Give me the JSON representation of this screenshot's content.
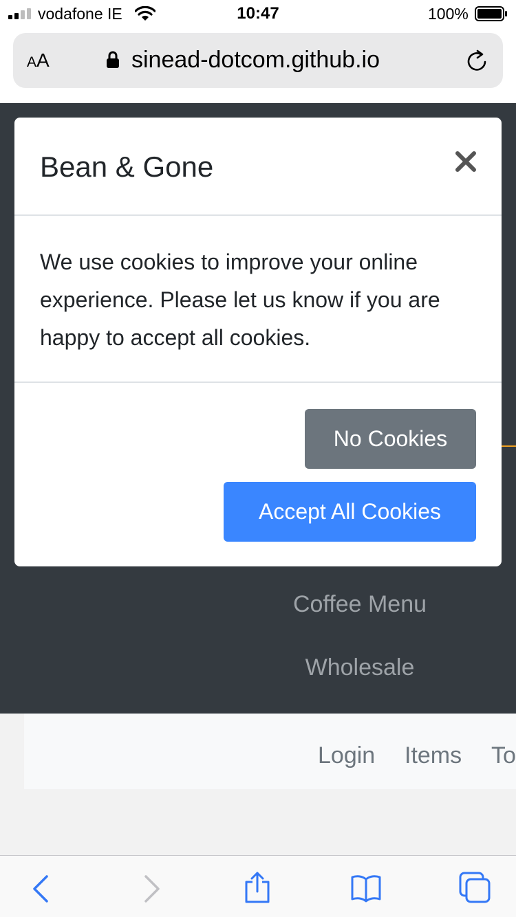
{
  "status_bar": {
    "carrier": "vodafone IE",
    "time": "10:47",
    "battery": "100%"
  },
  "browser": {
    "text_size_small": "A",
    "text_size_large": "A",
    "url": "sinead-dotcom.github.io"
  },
  "page": {
    "nav_links": [
      "Coffee Menu",
      "Wholesale"
    ],
    "sub_links": [
      "Login",
      "Items",
      "To"
    ]
  },
  "modal": {
    "title": "Bean & Gone",
    "body": "We use cookies to improve your online experience. Please let us know if you are happy to accept all cookies.",
    "no_cookies_label": "No Cookies",
    "accept_label": "Accept All Cookies"
  },
  "colors": {
    "navbar_bg": "#343a40",
    "primary": "#3a86ff",
    "secondary": "#6c757d",
    "browser_tint": "#3478f6"
  },
  "icons": {
    "close": "close-icon",
    "lock": "lock-icon",
    "reload": "reload-icon",
    "back": "chevron-left-icon",
    "forward": "chevron-right-icon",
    "share": "share-icon",
    "bookmarks": "book-icon",
    "tabs": "tabs-icon"
  }
}
